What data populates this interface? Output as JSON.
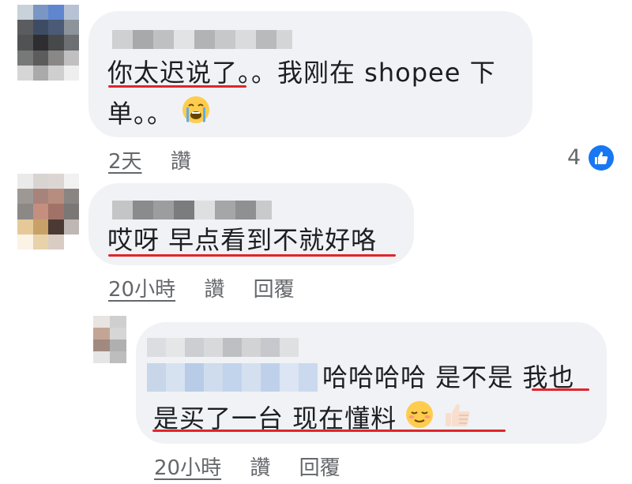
{
  "comments": [
    {
      "text_line1": "你太迟说了。。我刚在 shopee 下",
      "text_line2": "单。。",
      "emoji": "loudly-crying-face",
      "time": "2天",
      "action_like": "讚",
      "reaction_count": "4",
      "reaction_icon": "thumbs-up-icon"
    },
    {
      "text_line1": "哎呀 早点看到不就好咯",
      "time": "20小時",
      "action_like": "讚",
      "action_reply": "回覆"
    },
    {
      "text_line1": "哈哈哈哈 是不是 我也",
      "text_line2": "是买了一台 现在懂料",
      "emoji_1": "relieved-face",
      "emoji_2": "thumbs-up",
      "time": "20小時",
      "action_like": "讚",
      "action_reply": "回覆"
    }
  ],
  "colors": {
    "bubble": "#f0f2f5",
    "underline": "#e0252b",
    "meta": "#65676b",
    "like_badge": "#1877f2"
  }
}
